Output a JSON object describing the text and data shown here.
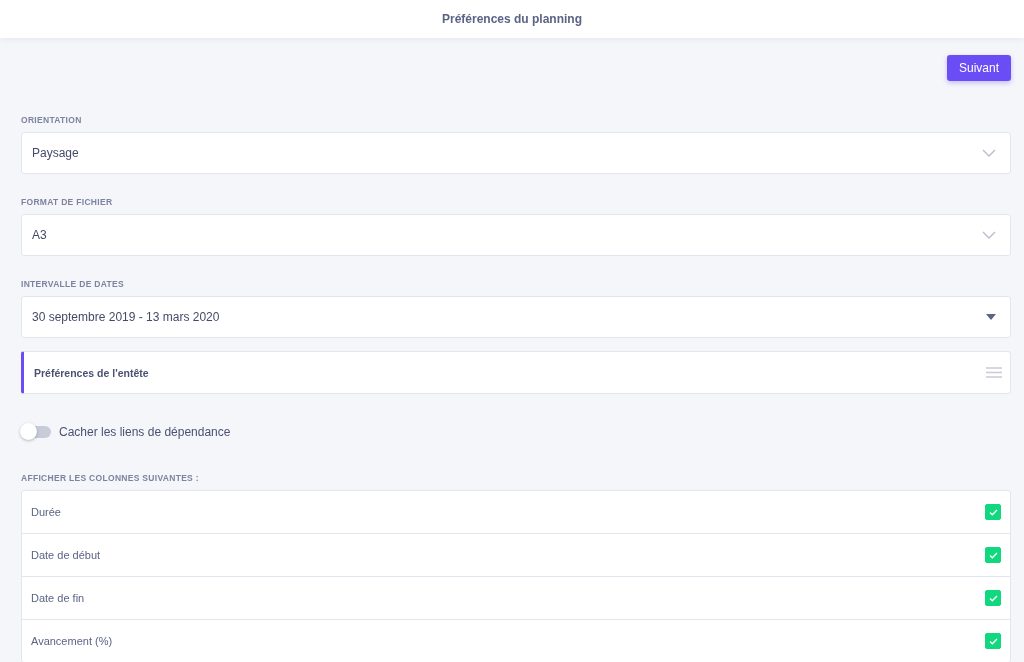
{
  "header": {
    "title": "Préférences du planning"
  },
  "next_button": "Suivant",
  "fields": [
    {
      "label": "ORIENTATION",
      "value": "Paysage",
      "kind": "chevron"
    },
    {
      "label": "FORMAT DE FICHIER",
      "value": "A3",
      "kind": "chevron"
    },
    {
      "label": "INTERVALLE DE DATES",
      "value": "30 septembre 2019 - 13 mars 2020",
      "kind": "caret"
    }
  ],
  "section": {
    "title": "Préférences de l'entête",
    "expanded": false
  },
  "toggle": {
    "label": "Cacher les liens de dépendance",
    "on": false
  },
  "columns_label": "AFFICHER LES COLONNES SUIVANTES :",
  "columns": [
    {
      "label": "Durée",
      "checked": true
    },
    {
      "label": "Date de début",
      "checked": true
    },
    {
      "label": "Date de fin",
      "checked": true
    },
    {
      "label": "Avancement (%)",
      "checked": true
    }
  ]
}
